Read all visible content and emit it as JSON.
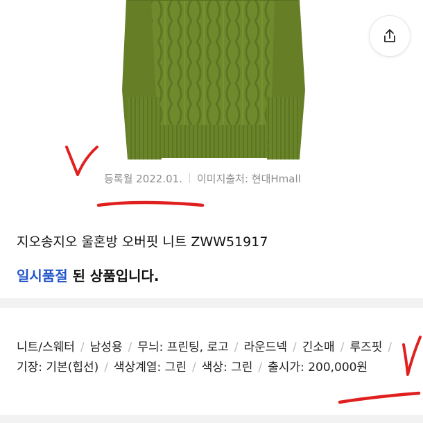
{
  "product_image": {
    "description": ""
  },
  "share_button": {
    "icon": "share-icon"
  },
  "meta": {
    "registered": "등록월 2022.01.",
    "image_source": "이미지출처: 현대Hmall"
  },
  "product": {
    "title": "지오송지오 울혼방 오버핏 니트 ZWW51917",
    "status_accent": "일시품절",
    "status_rest": " 된 상품입니다."
  },
  "attributes": [
    "니트/스웨터",
    "남성용",
    "무늬: 프린팅, 로고",
    "라운드넥",
    "긴소매",
    "루즈핏",
    "기장: 기본(힙선)",
    "색상계열: 그린",
    "색상: 그린",
    "출시가: 200,000원"
  ],
  "colors": {
    "sweater": "#6f8a2c",
    "accent": "#1f54c9",
    "annotation": "#e0201e"
  }
}
